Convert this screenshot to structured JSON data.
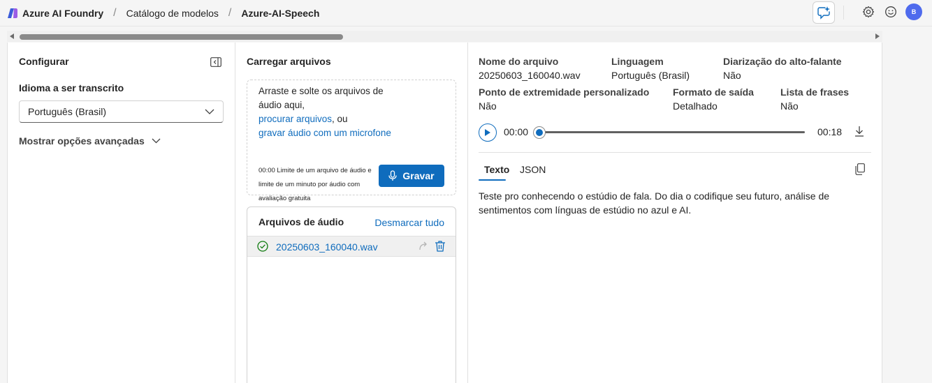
{
  "header": {
    "brand": "Azure AI Foundry",
    "breadcrumbs": [
      "Catálogo de modelos",
      "Azure-AI-Speech"
    ],
    "separator": "/",
    "avatar_initial": "B"
  },
  "config": {
    "title": "Configurar",
    "language_label": "Idioma a ser transcrito",
    "language_value": "Português (Brasil)",
    "advanced_label": "Mostrar opções avançadas"
  },
  "upload": {
    "title": "Carregar arquivos",
    "drop_text": "Arraste e solte os arquivos de áudio aqui,",
    "browse_link": "procurar arquivos",
    "or_text": ", ou",
    "record_link": "gravar áudio com um microfone",
    "limit_note": "00:00 Limite de um arquivo de áudio e limite de um minuto por áudio com avaliação gratuita",
    "record_button": "Gravar",
    "files_title": "Arquivos de áudio",
    "unselect_all": "Desmarcar tudo",
    "files": [
      "20250603_160040.wav"
    ]
  },
  "result": {
    "file_name_label": "Nome do arquivo",
    "file_name_value": "20250603_160040.wav",
    "language_label": "Linguagem",
    "language_value": "Português (Brasil)",
    "diarization_label": "Diarização do alto-falante",
    "diarization_value": "Não",
    "endpoint_label": "Ponto de extremidade personalizado",
    "endpoint_value": "Não",
    "format_label": "Formato de saída",
    "format_value": "Detalhado",
    "phrases_label": "Lista de frases",
    "phrases_value": "Não",
    "time_start": "00:00",
    "time_end": "00:18",
    "progress_fraction": 0,
    "tabs": [
      "Texto",
      "JSON"
    ],
    "active_tab": "Texto",
    "transcript": "Teste pro conhecendo o estúdio de fala. Do dia o codifique seu futuro, análise de sentimentos com línguas de estúdio no azul e AI."
  },
  "colors": {
    "accent": "#0f6cbd",
    "avatar": "#4f6bed",
    "success": "#107c10"
  },
  "icons": [
    "foundry-logo-icon",
    "copilot-icon",
    "settings-icon",
    "feedback-smile-icon",
    "panel-collapse-icon",
    "chevron-down-icon",
    "microphone-icon",
    "check-circle-icon",
    "retry-icon",
    "trash-icon",
    "play-icon",
    "download-icon",
    "copy-icon"
  ]
}
